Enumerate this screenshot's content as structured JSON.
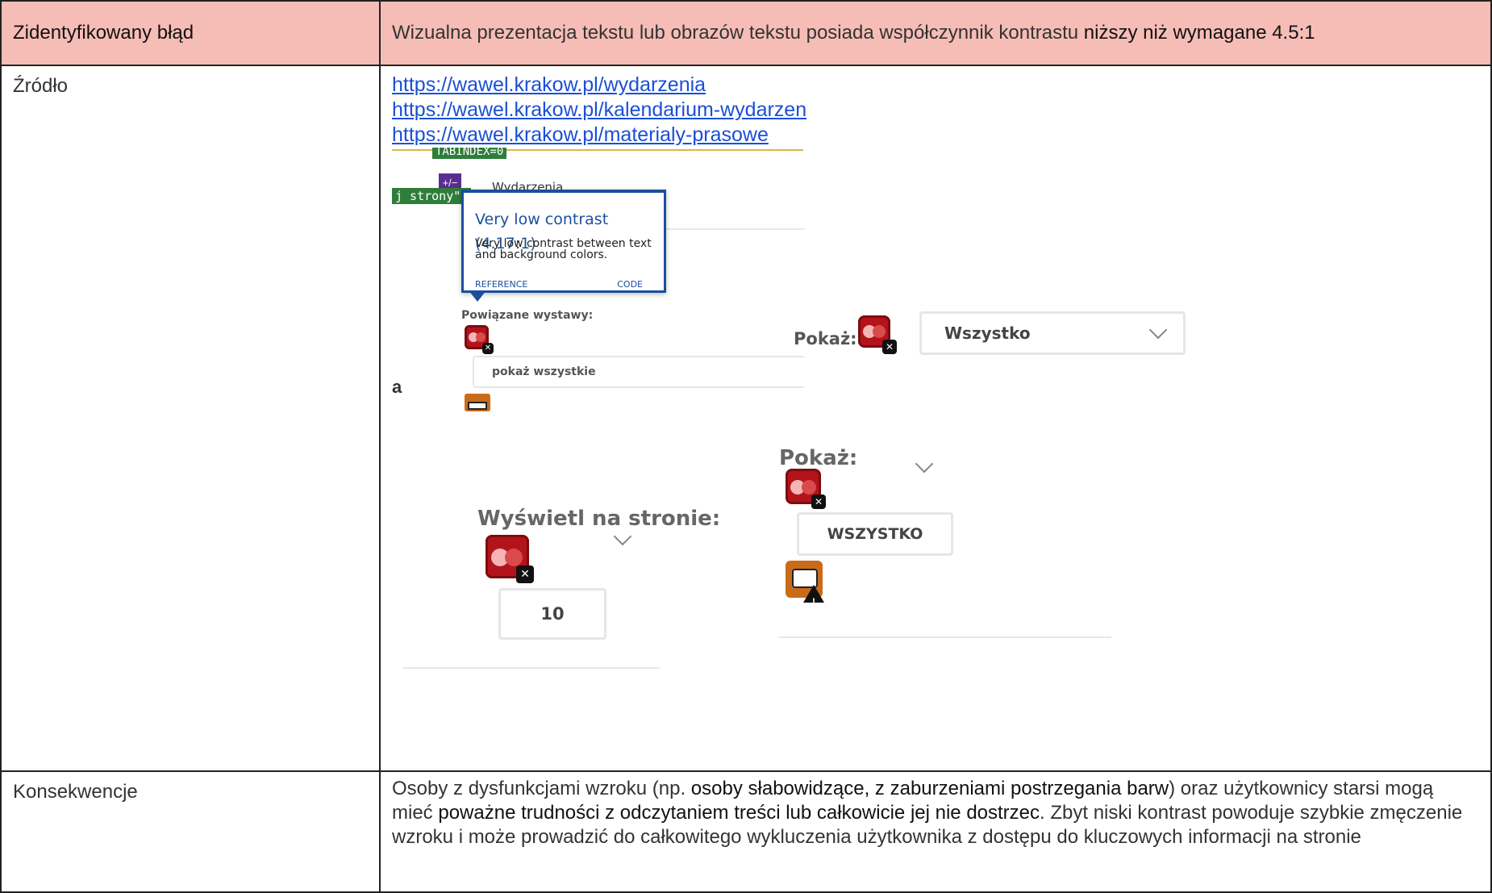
{
  "rows": {
    "error": {
      "label": "Zidentyfikowany błąd",
      "text_part1": "Wizualna prezentacja tekstu lub obrazów tekstu posiada współczynnik kontrastu ",
      "text_strong": "niższy niż wymagane 4.5:1"
    },
    "source": {
      "label": "Źródło",
      "links": [
        "https://wawel.krakow.pl/wydarzenia",
        "https://wawel.krakow.pl/kalendarium-wydarzen",
        "https://wawel.krakow.pl/materialy-prasowe"
      ]
    },
    "consequences": {
      "label": "Konsekwencje",
      "p1": "Osoby z dysfunkcjami wzroku (np. ",
      "s1": "osoby słabowidzące, z zaburzeniami postrzegania barw",
      "p2": ") oraz użytkownicy starsi mogą mieć ",
      "s2": "poważne trudności z odczytaniem treści lub całkowicie jej nie dostrzec",
      "p3": ". Zbyt niski kontrast powoduje szybkie zmęczenie wzroku i może prowadzić do całkowitego wykluczenia użytkownika z dostępu do kluczowych informacji na stronie"
    }
  },
  "screenshot": {
    "tabindex_tag": "TABINDEX=0",
    "strony_tag": "j strony\"*",
    "purple_icon": "+/−",
    "menu_label": "Wydarzenia",
    "tooltip": {
      "title": "Very low contrast (4.17:1)",
      "body": "Very low contrast between text and background colors.",
      "reference": "REFERENCE",
      "code": "CODE"
    },
    "related_label": "Powiązane wystawy:",
    "show_all": "pokaż wszystkie",
    "cut_letter": "a",
    "show_label_1": "Pokaż:",
    "select_value_1": "Wszystko",
    "show_label_2": "Pokaż:",
    "select_value_2": "WSZYSTKO",
    "display_label": "Wyświetl na stronie:",
    "display_value": "10",
    "x_mark": "✕",
    "warn_mark": "!"
  },
  "colors": {
    "header_bg": "#f6bdb6",
    "link": "#1a4fd6",
    "contrast_error_icon": "#b3141c",
    "tooltip_accent": "#1b4f9c"
  }
}
